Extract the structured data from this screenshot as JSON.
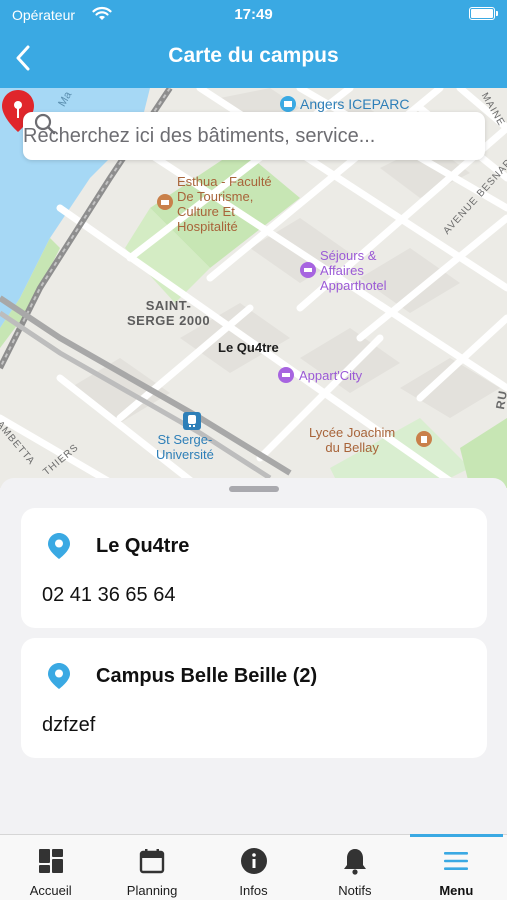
{
  "status_bar": {
    "carrier": "Opérateur",
    "time": "17:49"
  },
  "header": {
    "title": "Carte du campus"
  },
  "search": {
    "placeholder": "Recherchez ici des bâtiments, service..."
  },
  "map": {
    "labels": {
      "angers_iceparc": "Angers ICEPARC",
      "esthua": "Esthua - Faculté\nDe Tourisme,\nCulture Et\nHospitalité",
      "sejours": "Séjours &\nAffaires\nApparthotel",
      "saint_serge": "SAINT-\nSERGE 2000",
      "apparcity": "Appart'City",
      "lycee": "Lycée Joachim\ndu Bellay",
      "st_serge_univ": "St Serge-\nUniversité",
      "avenue_besnard": "AVENUE BESNARD",
      "ambetta": "AMBETTA",
      "thiers": "THIERS",
      "maine": "MAINE",
      "ru": "RU",
      "ma": "Ma"
    },
    "selected_pin_label": "Le Qu4tre"
  },
  "cards": [
    {
      "title": "Le Qu4tre",
      "detail": "02 41 36 65 64",
      "icon": "location-pin-icon"
    },
    {
      "title": "Campus Belle Beille (2)",
      "detail": "dzfzef",
      "icon": "location-pin-icon"
    }
  ],
  "tabs": [
    {
      "label": "Accueil",
      "icon": "dashboard-icon"
    },
    {
      "label": "Planning",
      "icon": "calendar-icon"
    },
    {
      "label": "Infos",
      "icon": "info-icon"
    },
    {
      "label": "Notifs",
      "icon": "bell-icon"
    },
    {
      "label": "Menu",
      "icon": "hamburger-icon",
      "active": true
    }
  ],
  "colors": {
    "accent": "#3aa9e3",
    "pin_red": "#e0262b",
    "water": "#a6d8f5",
    "park": "#c7e6b4"
  }
}
